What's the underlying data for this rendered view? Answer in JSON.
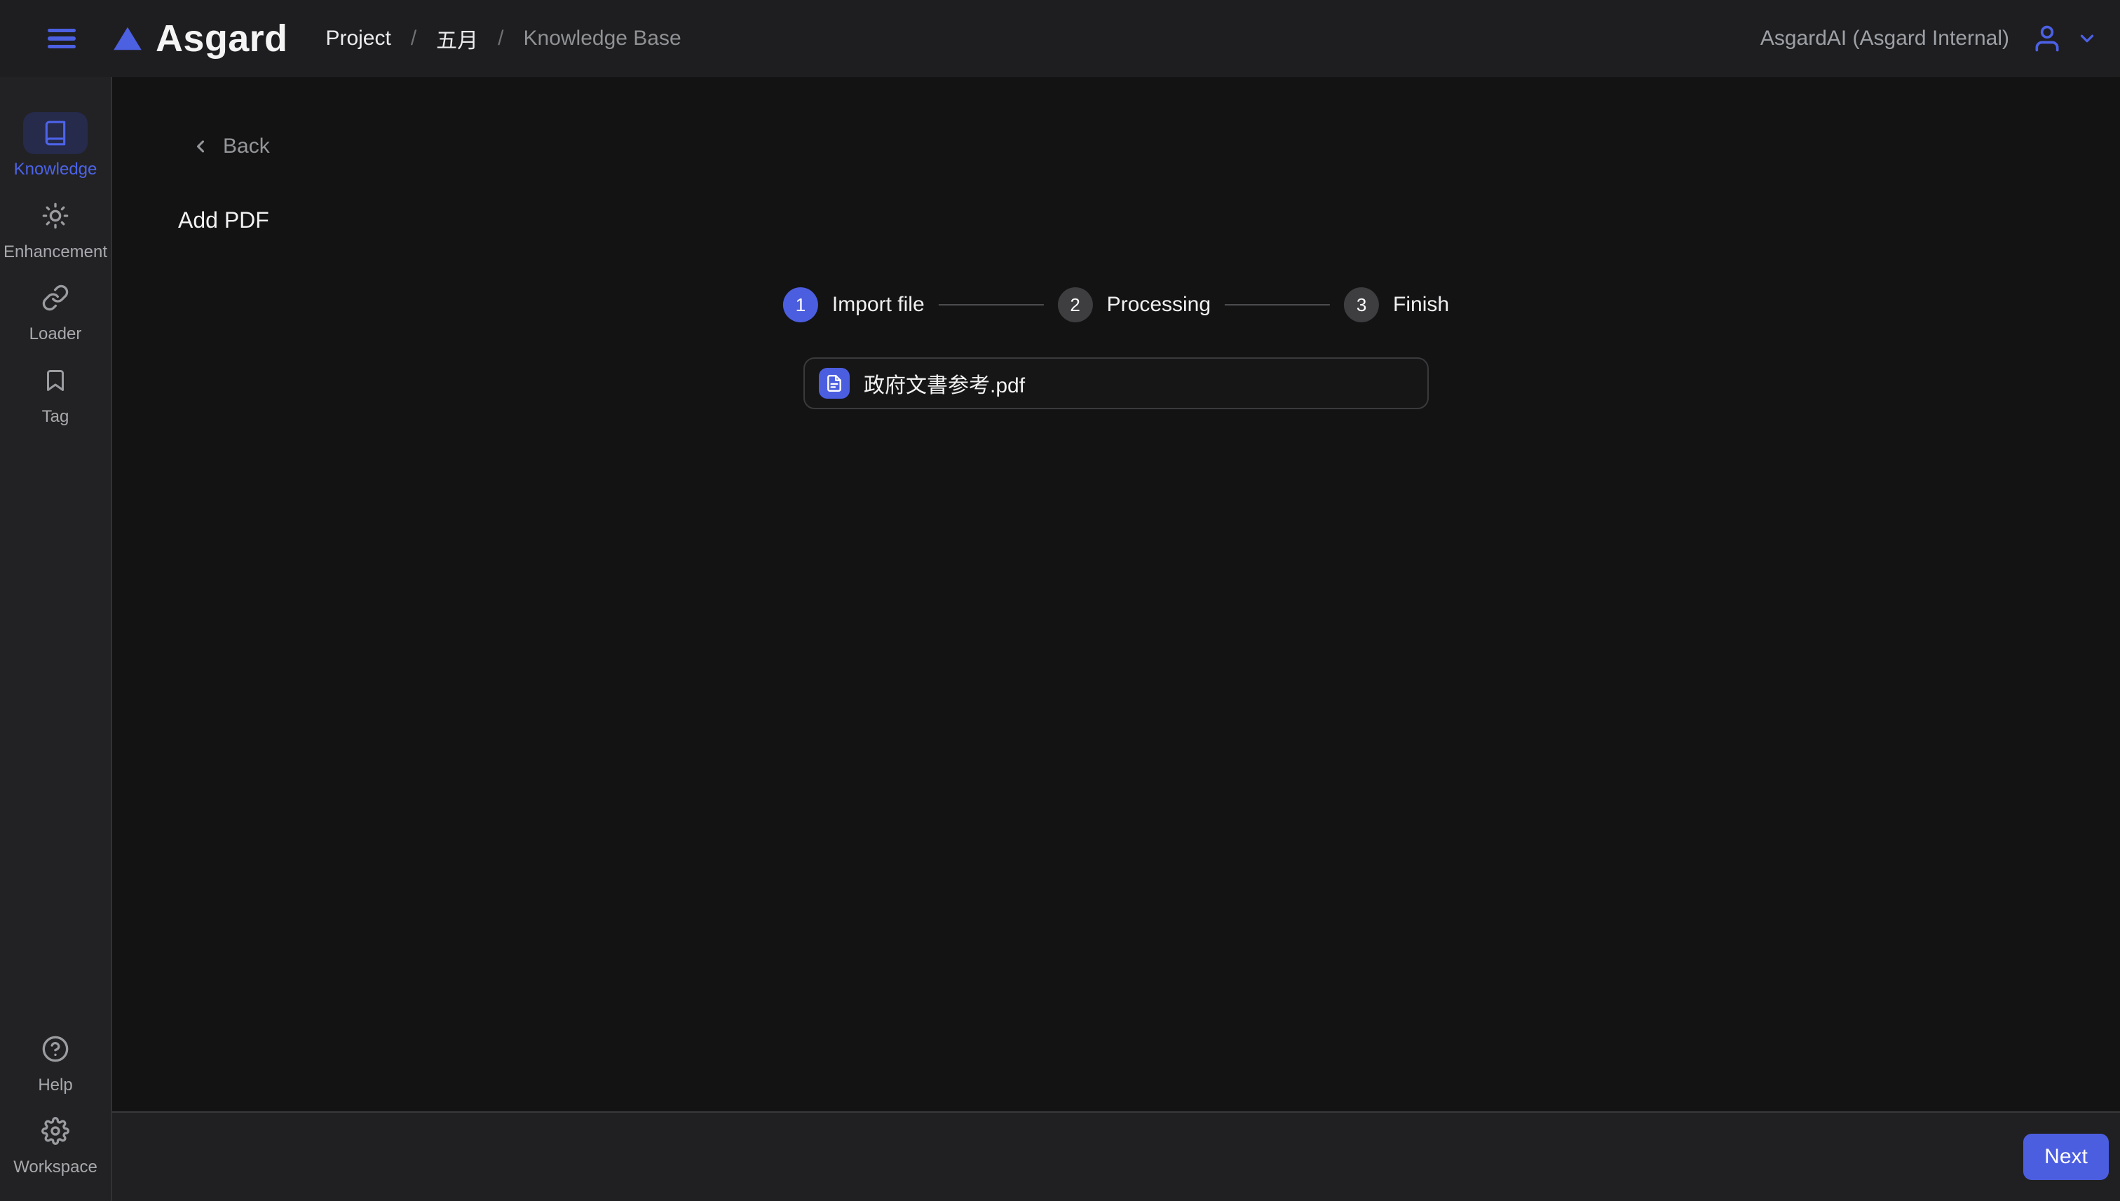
{
  "header": {
    "logo_text": "Asgard",
    "breadcrumb_separator": "/",
    "breadcrumb": [
      {
        "label": "Project"
      },
      {
        "label": "五月"
      },
      {
        "label": "Knowledge Base"
      }
    ],
    "account_label": "AsgardAI (Asgard Internal)"
  },
  "sidebar": {
    "items": [
      {
        "label": "Knowledge",
        "icon": "book-icon",
        "active": true
      },
      {
        "label": "Enhancement",
        "icon": "sun-icon",
        "active": false
      },
      {
        "label": "Loader",
        "icon": "link-icon",
        "active": false
      },
      {
        "label": "Tag",
        "icon": "bookmark-icon",
        "active": false
      }
    ],
    "bottom_items": [
      {
        "label": "Help",
        "icon": "help-circle-icon"
      },
      {
        "label": "Workspace",
        "icon": "gear-icon"
      }
    ]
  },
  "main": {
    "back_label": "Back",
    "page_title": "Add PDF",
    "stepper": [
      {
        "number": "1",
        "label": "Import file",
        "active": true
      },
      {
        "number": "2",
        "label": "Processing",
        "active": false
      },
      {
        "number": "3",
        "label": "Finish",
        "active": false
      }
    ],
    "file": {
      "name": "政府文書参考.pdf",
      "icon": "document-icon"
    }
  },
  "footer": {
    "next_label": "Next"
  },
  "colors": {
    "accent": "#4c5ee0",
    "active_item_bg": "#262a4b",
    "header_bg": "#1e1e20",
    "sidebar_bg": "#222224",
    "main_bg": "#131314",
    "footer_bg": "#202022"
  }
}
